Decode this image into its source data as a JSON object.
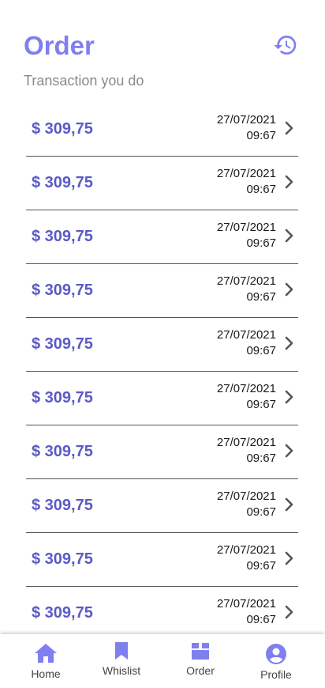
{
  "header": {
    "title": "Order",
    "subtitle": "Transaction you do",
    "history_icon": "history-icon"
  },
  "colors": {
    "accent": "#7f7ff0",
    "amount": "#5a5ac8",
    "nav_icon": "#7f7ff0"
  },
  "orders": [
    {
      "amount": "$ 309,75",
      "date": "27/07/2021",
      "time": "09:67"
    },
    {
      "amount": "$ 309,75",
      "date": "27/07/2021",
      "time": "09:67"
    },
    {
      "amount": "$ 309,75",
      "date": "27/07/2021",
      "time": "09:67"
    },
    {
      "amount": "$ 309,75",
      "date": "27/07/2021",
      "time": "09:67"
    },
    {
      "amount": "$ 309,75",
      "date": "27/07/2021",
      "time": "09:67"
    },
    {
      "amount": "$ 309,75",
      "date": "27/07/2021",
      "time": "09:67"
    },
    {
      "amount": "$ 309,75",
      "date": "27/07/2021",
      "time": "09:67"
    },
    {
      "amount": "$ 309,75",
      "date": "27/07/2021",
      "time": "09:67"
    },
    {
      "amount": "$ 309,75",
      "date": "27/07/2021",
      "time": "09:67"
    },
    {
      "amount": "$ 309,75",
      "date": "27/07/2021",
      "time": "09:67"
    }
  ],
  "nav": {
    "items": [
      {
        "label": "Home",
        "icon": "home-icon"
      },
      {
        "label": "Whislist",
        "icon": "bookmark-icon"
      },
      {
        "label": "Order",
        "icon": "box-icon"
      },
      {
        "label": "Profile",
        "icon": "account-circle-icon"
      }
    ]
  }
}
